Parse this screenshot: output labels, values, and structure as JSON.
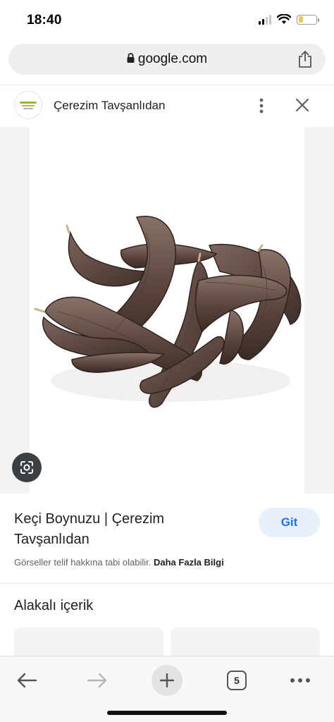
{
  "status_bar": {
    "time": "18:40",
    "icons": [
      "cellular-signal-icon",
      "wifi-icon",
      "battery-icon"
    ],
    "battery_level": 0.25
  },
  "browser": {
    "url": "google.com",
    "icons": [
      "lock-icon",
      "share-icon"
    ]
  },
  "source": {
    "name": "Çerezim Tavşanlıdan",
    "icons": [
      "more-vertical-icon",
      "close-icon"
    ]
  },
  "image_viewer": {
    "subject": "carob pods",
    "lens_icon": "google-lens-icon"
  },
  "info": {
    "title": "Keçi Boynuzu | Çerezim Tavşanlıdan",
    "go_label": "Git",
    "copyright_text": "Görseller telif hakkına tabi olabilir.",
    "more_info_label": "Daha Fazla Bilgi"
  },
  "related": {
    "heading": "Alakalı içerik"
  },
  "toolbar": {
    "tab_count": "5",
    "icons": [
      "back-arrow-icon",
      "forward-arrow-icon",
      "plus-icon",
      "tabs-icon",
      "more-horizontal-icon"
    ]
  },
  "colors": {
    "accent": "#1a73e8",
    "go_button_bg": "#e8f0fe",
    "battery": "#f2c94c"
  }
}
